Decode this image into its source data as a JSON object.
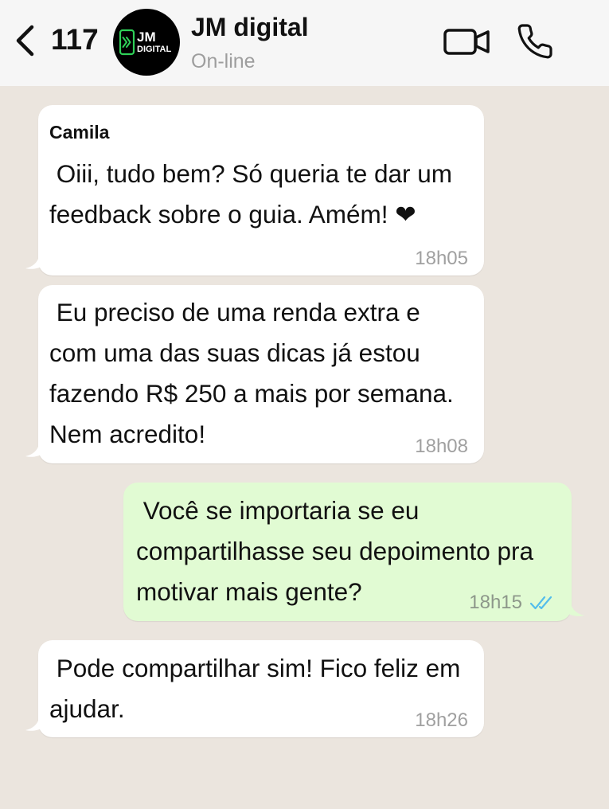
{
  "header": {
    "back_icon": "chevron-left-icon",
    "unread_count": "117",
    "avatar_logo": {
      "icon": "door-arrow-icon",
      "text_top": "JM",
      "text_bottom": "DIGITAL"
    },
    "contact_name": "JM digital",
    "status": "On-line",
    "actions": [
      {
        "icon": "video-camera-icon"
      },
      {
        "icon": "phone-icon"
      }
    ]
  },
  "messages": [
    {
      "direction": "incoming",
      "sender": "Camila",
      "lines": [
        " Oiii, tudo bem? Só queria te dar um",
        "feedback sobre o guia. Amém! ❤"
      ],
      "time": "18h05"
    },
    {
      "direction": "incoming",
      "lines": [
        " Eu preciso de uma renda extra e",
        "com uma das suas dicas já estou",
        "fazendo R$ 250 a mais por semana.",
        "Nem acredito!"
      ],
      "time": "18h08"
    },
    {
      "direction": "outgoing",
      "lines": [
        " Você se importaria se eu",
        "compartilhasse seu depoimento pra",
        "motivar mais gente?"
      ],
      "time": "18h15",
      "status_icon": "double-check-icon"
    },
    {
      "direction": "incoming",
      "lines": [
        " Pode compartilhar sim! Fico feliz em",
        "ajudar."
      ],
      "time": "18h26"
    }
  ],
  "colors": {
    "header_bg": "#f6f6f6",
    "chat_bg": "#ebe5de",
    "incoming_bubble": "#ffffff",
    "outgoing_bubble": "#e1fbd3",
    "status_text": "#9e9e9e",
    "read_check": "#53bdeb",
    "logo_green": "#2fd158"
  }
}
